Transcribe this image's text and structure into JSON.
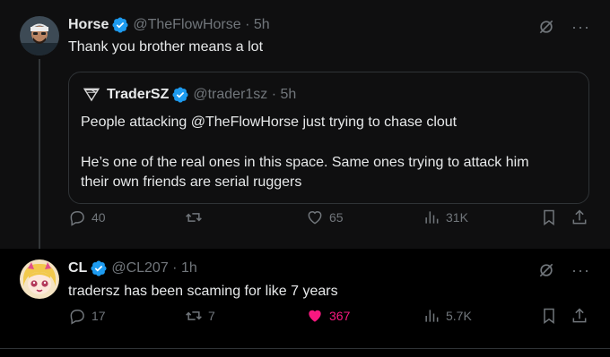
{
  "tweets": [
    {
      "name": "Horse",
      "handle": "@TheFlowHorse · 5h",
      "text": "Thank you brother means a lot",
      "quote": {
        "name": "TraderSZ",
        "handle": "@trader1sz · 5h",
        "line1": "People attacking @TheFlowHorse just trying to chase clout",
        "line2": "He’s one of the real ones in this space. Same ones trying to attack him",
        "line3": "their own friends are serial ruggers"
      },
      "stats": {
        "replies": "40",
        "reposts": "",
        "likes": "65",
        "views": "31K"
      }
    },
    {
      "name": "CL",
      "handle": "@CL207 · 1h",
      "text": "tradersz has been scaming for like 7 years",
      "stats": {
        "replies": "17",
        "reposts": "7",
        "likes": "367",
        "views": "5.7K"
      }
    }
  ],
  "icons": {
    "verified": "verified-badge-icon",
    "grok": "grok-icon",
    "more": "more-icon",
    "reply": "reply-icon",
    "repost": "repost-icon",
    "like": "heart-icon",
    "views": "views-icon",
    "bookmark": "bookmark-icon",
    "share": "share-icon"
  },
  "colors": {
    "verified": "#1d9bf0",
    "liked": "#f91880",
    "muted": "#71767b",
    "text": "#e7e9ea"
  }
}
